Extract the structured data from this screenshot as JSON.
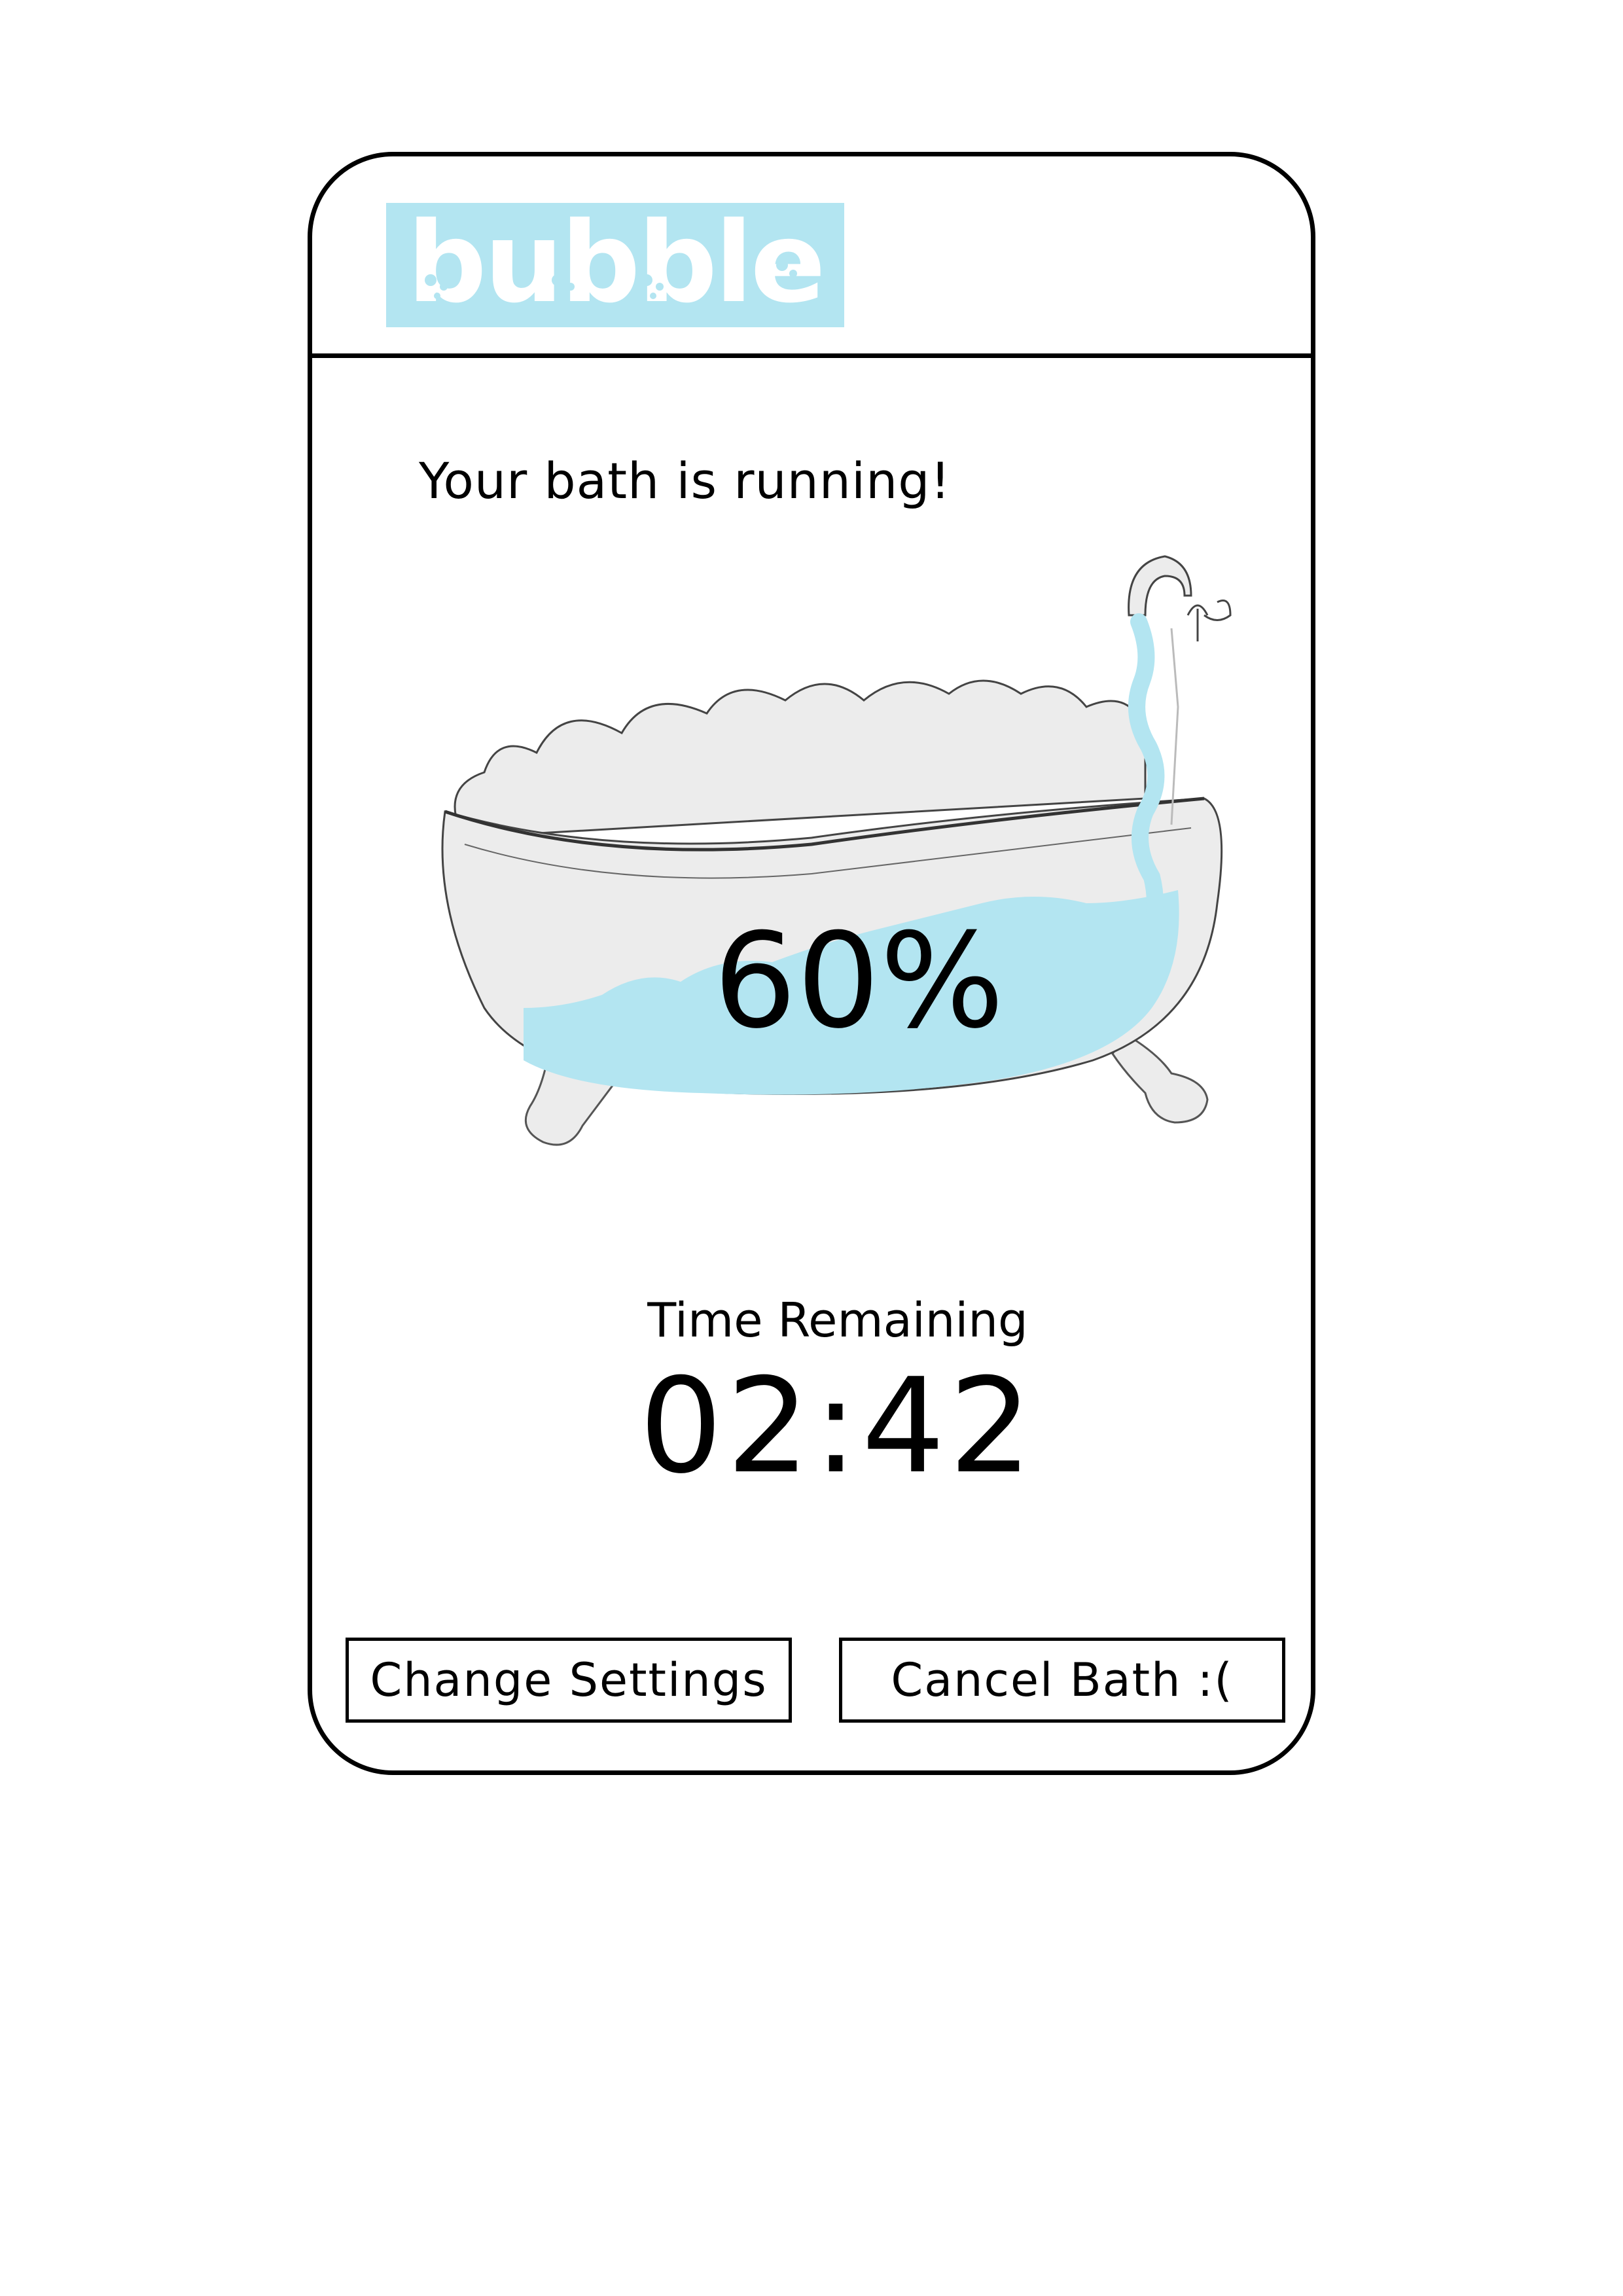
{
  "app": {
    "logo_text": "bubble",
    "brand_color": "#b3e5f1"
  },
  "main": {
    "status_text": "Your bath is running!",
    "fill_percent_label": "60%",
    "fill_percent_value": 60,
    "time_label": "Time Remaining",
    "time_value": "02:42"
  },
  "actions": {
    "change_settings_label": "Change Settings",
    "cancel_bath_label": "Cancel Bath :("
  },
  "illustration": {
    "icon": "bathtub-icon",
    "water_color": "#b3e5f1",
    "tub_color": "#ececec"
  }
}
